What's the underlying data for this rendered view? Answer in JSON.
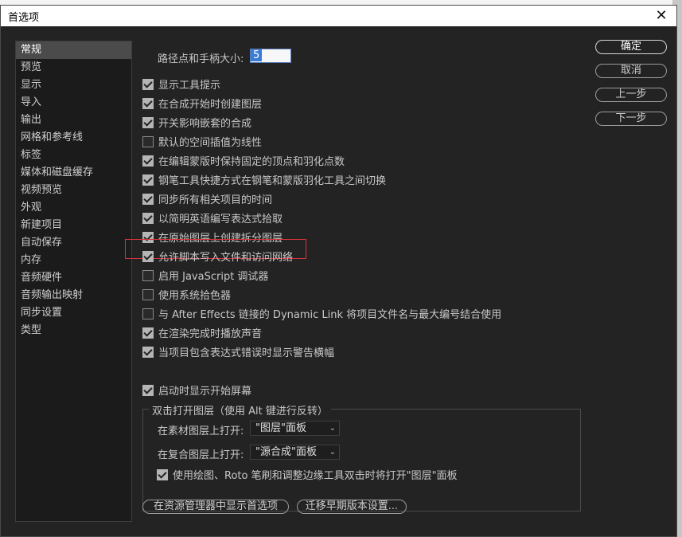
{
  "window": {
    "title": "首选项",
    "close_glyph": "✕"
  },
  "sidebar": {
    "items": [
      {
        "label": "常规",
        "selected": true
      },
      {
        "label": "预览"
      },
      {
        "label": "显示"
      },
      {
        "label": "导入"
      },
      {
        "label": "输出"
      },
      {
        "label": "网格和参考线"
      },
      {
        "label": "标签"
      },
      {
        "label": "媒体和磁盘缓存"
      },
      {
        "label": "视频预览"
      },
      {
        "label": "外观"
      },
      {
        "label": "新建项目"
      },
      {
        "label": "自动保存"
      },
      {
        "label": "内存"
      },
      {
        "label": "音频硬件"
      },
      {
        "label": "音频输出映射"
      },
      {
        "label": "同步设置"
      },
      {
        "label": "类型"
      }
    ]
  },
  "general": {
    "path_handle_label": "路径点和手柄大小:",
    "path_handle_value": "5",
    "options": [
      {
        "label": "显示工具提示",
        "checked": true
      },
      {
        "label": "在合成开始时创建图层",
        "checked": true
      },
      {
        "label": "开关影响嵌套的合成",
        "checked": true
      },
      {
        "label": "默认的空间插值为线性",
        "checked": false
      },
      {
        "label": "在编辑蒙版时保持固定的顶点和羽化点数",
        "checked": true
      },
      {
        "label": "钢笔工具快捷方式在钢笔和蒙版羽化工具之间切换",
        "checked": true
      },
      {
        "label": "同步所有相关项目的时间",
        "checked": true
      },
      {
        "label": "以简明英语编写表达式拾取",
        "checked": true
      },
      {
        "label": "在原始图层上创建拆分图层",
        "checked": true
      },
      {
        "label": "允许脚本写入文件和访问网络",
        "checked": true
      },
      {
        "label": "启用 JavaScript 调试器",
        "checked": false
      },
      {
        "label": "使用系统拾色器",
        "checked": false
      },
      {
        "label": "与 After Effects 链接的 Dynamic Link 将项目文件名与最大编号结合使用",
        "checked": false
      },
      {
        "label": "在渲染完成时播放声音",
        "checked": true
      },
      {
        "label": "当项目包含表达式错误时显示警告横幅",
        "checked": true
      }
    ],
    "startup": {
      "label": "启动时显示开始屏幕",
      "checked": true
    }
  },
  "double_click": {
    "legend": "双击打开图层（使用 Alt 键进行反转）",
    "footage_label": "在素材图层上打开:",
    "footage_value": "\"图层\"面板",
    "comp_label": "在复合图层上打开:",
    "comp_value": "\"源合成\"面板",
    "paint_option": {
      "label": "使用绘图、Roto 笔刷和调整边缘工具双击时将打开\"图层\"面板",
      "checked": true
    }
  },
  "buttons": {
    "ok": "确定",
    "cancel": "取消",
    "prev": "上一步",
    "next": "下一步",
    "reveal": "在资源管理器中显示首选项",
    "migrate": "迁移早期版本设置..."
  },
  "colors": {
    "panel": "#232323",
    "highlight_border": "#d9343a",
    "accent_selection": "#3a7bd5"
  }
}
